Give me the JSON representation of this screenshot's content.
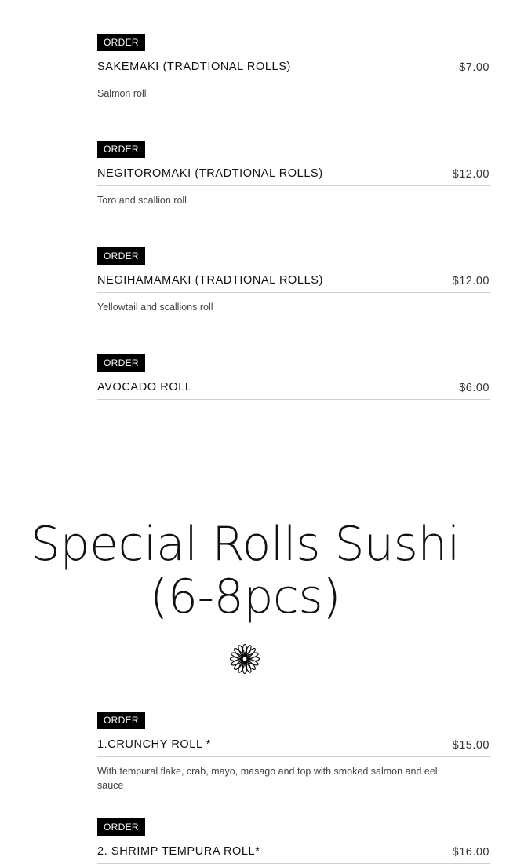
{
  "order_label": "ORDER",
  "items_top": [
    {
      "name": "SAKEMAKI (TRADTIONAL ROLLS)",
      "price": "$7.00",
      "description": "Salmon roll"
    },
    {
      "name": "NEGITOROMAKI (TRADTIONAL ROLLS)",
      "price": "$12.00",
      "description": "Toro and scallion roll"
    },
    {
      "name": "NEGIHAMAMAKI (TRADTIONAL ROLLS)",
      "price": "$12.00",
      "description": "Yellowtail and scallions roll"
    },
    {
      "name": "AVOCADO ROLL",
      "price": "$6.00",
      "description": ""
    }
  ],
  "section": {
    "title": "Special Rolls Sushi (6-8pcs)",
    "divider_icon": "flower-ornament-icon"
  },
  "items_special": [
    {
      "name": "1.CRUNCHY ROLL *",
      "price": "$15.00",
      "description": "With tempural flake, crab, mayo, masago and top with smoked salmon and eel sauce"
    },
    {
      "name": "2. SHRIMP TEMPURA ROLL*",
      "price": "$16.00",
      "description": ""
    }
  ]
}
